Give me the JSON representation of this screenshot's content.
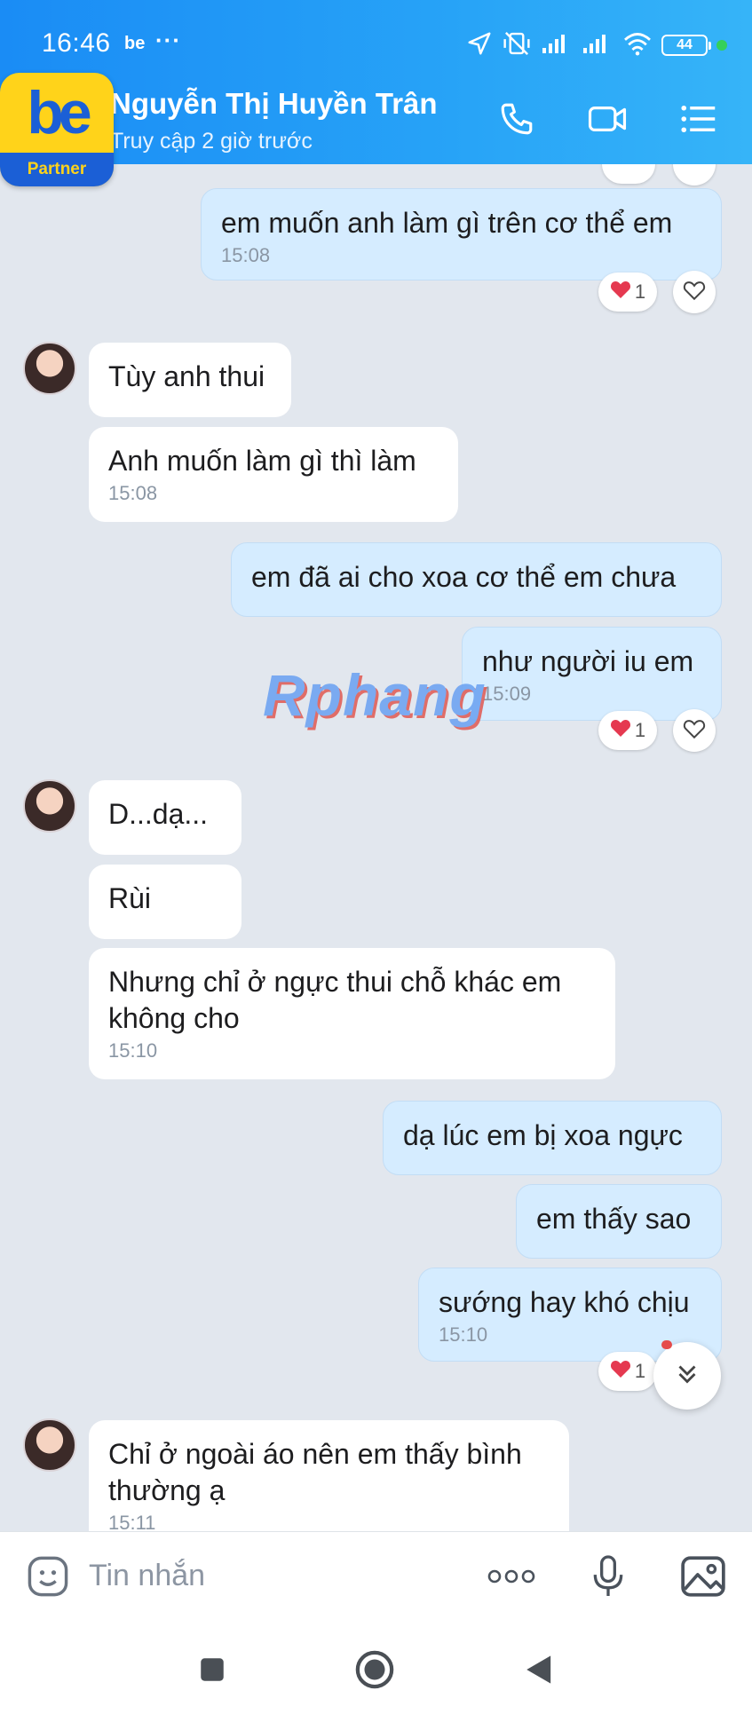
{
  "status_bar": {
    "time": "16:46",
    "app_badge": "be",
    "more": "···",
    "battery": "44",
    "icons": [
      "location-arrow-icon",
      "vibrate-off-icon",
      "signal-icon",
      "signal-icon",
      "wifi-icon"
    ]
  },
  "app_badge": {
    "logo": "be",
    "label": "Partner"
  },
  "header": {
    "contact_name": "Nguyễn Thị Huyền Trân",
    "last_seen": "Truy cập 2 giờ trước",
    "actions": [
      "phone-icon",
      "video-call-icon",
      "menu-list-icon"
    ]
  },
  "messages": [
    {
      "side": "out",
      "text": "em muốn anh làm gì trên cơ thể em",
      "time": "15:08",
      "reaction_count": "1"
    },
    {
      "side": "in",
      "text": "Tùy anh thui"
    },
    {
      "side": "in",
      "text": "Anh muốn làm gì thì làm",
      "time": "15:08"
    },
    {
      "side": "out",
      "text": "em đã ai cho xoa cơ thể em chưa"
    },
    {
      "side": "out",
      "text": "như người iu em",
      "time": "15:09",
      "reaction_count": "1"
    },
    {
      "side": "in",
      "text": "D...dạ..."
    },
    {
      "side": "in",
      "text": "Rùi"
    },
    {
      "side": "in",
      "text": "Nhưng chỉ ở ngực thui chỗ khác em không cho",
      "time": "15:10"
    },
    {
      "side": "out",
      "text": "dạ lúc em bị xoa ngực"
    },
    {
      "side": "out",
      "text": "em thấy sao"
    },
    {
      "side": "out",
      "text": "sướng hay khó chịu",
      "time": "15:10",
      "reaction_count": "1"
    },
    {
      "side": "in",
      "text": "Chỉ ở ngoài áo nên em thấy bình thường ạ",
      "time": "15:11"
    }
  ],
  "watermark": "Rphang",
  "input": {
    "placeholder": "Tin nhắn"
  },
  "colors": {
    "header": "#1a8cf5",
    "outgoing_bubble": "#d5ecff",
    "incoming_bubble": "#ffffff",
    "background": "#e2e7ee",
    "reaction_heart": "#e53950"
  }
}
